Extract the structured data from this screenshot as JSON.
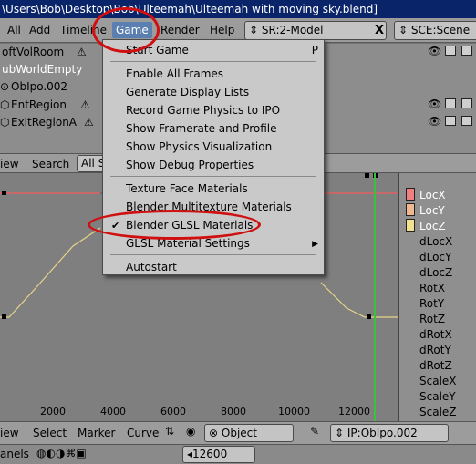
{
  "window": {
    "title": "\\Users\\Bob\\Desktop\\Bob\\Ulteemah\\Ulteemah with moving sky.blend]"
  },
  "menubar": {
    "items": [
      "All",
      "Add",
      "Timeline",
      "Game",
      "Render",
      "Help"
    ],
    "screen_field": "SR:2-Model",
    "scene_field": "SCE:Scene",
    "close_glyph": "X"
  },
  "outliner": {
    "rows": [
      {
        "name": "oftVolRoom",
        "selected": false
      },
      {
        "name": "ubWorldEmpty",
        "selected": true
      },
      {
        "name": "ObIpo.002",
        "selected": false
      },
      {
        "name": "EntRegion",
        "selected": false
      },
      {
        "name": "ExitRegionA",
        "selected": false
      }
    ]
  },
  "ipo_header": {
    "view": "iew",
    "search": "Search",
    "filter": "All Sc"
  },
  "game_menu": {
    "start_game": "Start Game",
    "start_game_shortcut": "P",
    "enable_all_frames": "Enable All Frames",
    "generate_display_lists": "Generate Display Lists",
    "record_game_physics": "Record Game Physics to IPO",
    "show_framerate": "Show Framerate and Profile",
    "show_physics": "Show Physics Visualization",
    "show_debug": "Show Debug Properties",
    "texture_face": "Texture Face Materials",
    "blender_multitexture": "Blender Multitexture Materials",
    "blender_glsl": "Blender GLSL Materials",
    "glsl_settings": "GLSL Material Settings",
    "autostart": "Autostart",
    "check_glyph": "✔",
    "submenu_glyph": "▶"
  },
  "channels": [
    "LocX",
    "LocY",
    "LocZ",
    "dLocX",
    "dLocY",
    "dLocZ",
    "RotX",
    "RotY",
    "RotZ",
    "dRotX",
    "dRotY",
    "dRotZ",
    "ScaleX",
    "ScaleY",
    "ScaleZ"
  ],
  "channel_colors": {
    "LocX": "#f08080",
    "LocY": "#f0b890",
    "LocZ": "#f0e090"
  },
  "ruler": [
    "2000",
    "4000",
    "6000",
    "8000",
    "10000",
    "12000"
  ],
  "bottombar": {
    "view": "iew",
    "select": "Select",
    "marker": "Marker",
    "curve": "Curve",
    "object_type": "Object",
    "ipo_block": "IP:ObIpo.002"
  },
  "panelbar": {
    "label": "anels",
    "frame": "12600"
  },
  "colors": {
    "curve": "#e8d488",
    "current_frame_line": "#39c23a",
    "highlight_ring": "#d01010",
    "menu_active": "#5b7fb0",
    "titlebar": "#0a246a"
  }
}
